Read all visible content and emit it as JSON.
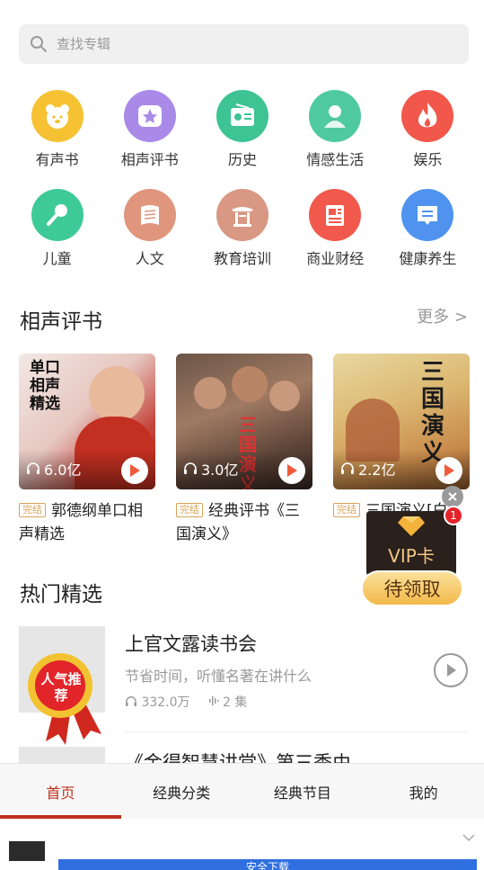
{
  "search": {
    "placeholder": "查找专辑"
  },
  "categories": [
    {
      "label": "有声书",
      "icon": "bear-icon",
      "color": "#f6c233"
    },
    {
      "label": "相声评书",
      "icon": "star-icon",
      "color": "#a98ae8"
    },
    {
      "label": "历史",
      "icon": "radio-icon",
      "color": "#3ec394"
    },
    {
      "label": "情感生活",
      "icon": "person-icon",
      "color": "#4fc9a0"
    },
    {
      "label": "娱乐",
      "icon": "flame-icon",
      "color": "#f2574b"
    },
    {
      "label": "儿童",
      "icon": "microphone-icon",
      "color": "#3ec999"
    },
    {
      "label": "人文",
      "icon": "book-icon",
      "color": "#e0957d"
    },
    {
      "label": "教育培训",
      "icon": "pavilion-icon",
      "color": "#d99883"
    },
    {
      "label": "商业财经",
      "icon": "newspaper-icon",
      "color": "#f0594b"
    },
    {
      "label": "健康养生",
      "icon": "message-icon",
      "color": "#4f93ee"
    }
  ],
  "section1": {
    "title": "相声评书",
    "more": "更多 >"
  },
  "albums": [
    {
      "plays": "6.0亿",
      "badge": "完结",
      "title": "郭德纲单口相声精选",
      "cover_text": "单口相声精选"
    },
    {
      "plays": "3.0亿",
      "badge": "完结",
      "title": "经典评书《三国演义》",
      "cover_text": "三国演义"
    },
    {
      "plays": "2.2亿",
      "badge": "完结",
      "title": "三国演义[白",
      "cover_text": "三国演义"
    }
  ],
  "section2": {
    "title": "热门精选"
  },
  "hot": [
    {
      "title": "上官文露读书会",
      "desc": "节省时间，听懂名著在讲什么",
      "plays": "332.0万",
      "episodes": "2 集",
      "badge_text": "人气推荐"
    },
    {
      "title": "《金得智慧讲堂》第三季由…"
    }
  ],
  "vip": {
    "label": "VIP卡",
    "cta": "待领取",
    "count": "1"
  },
  "tabs": [
    {
      "label": "首页"
    },
    {
      "label": "经典分类"
    },
    {
      "label": "经典节目"
    },
    {
      "label": "我的"
    }
  ],
  "ad": {
    "button": "安全下载"
  },
  "colors": {
    "accent": "#c0301f",
    "play": "#f05a3a"
  }
}
